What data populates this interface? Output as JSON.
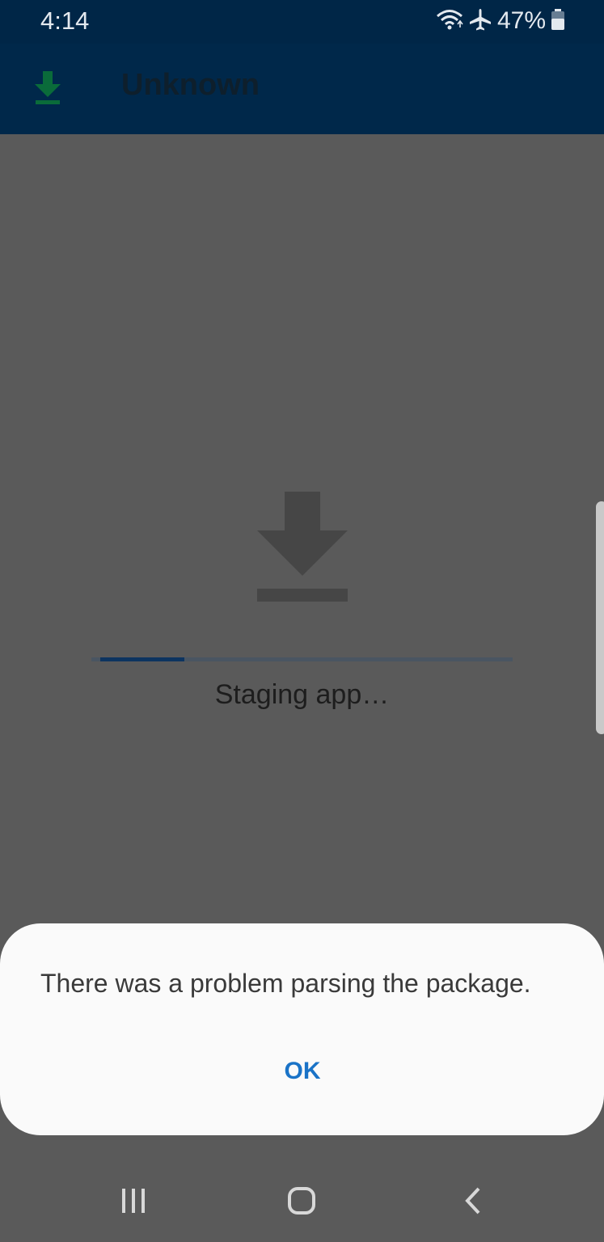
{
  "status_bar": {
    "time": "4:14",
    "battery_percent": "47%",
    "icons": [
      "wifi-icon",
      "airplane-icon",
      "battery-icon"
    ]
  },
  "app_bar": {
    "title": "Unknown",
    "icon": "download-icon",
    "icon_color": "#0a6b3a"
  },
  "content": {
    "graphic": "download-icon",
    "progress_label": "Staging app…",
    "progress_fraction": 0.2
  },
  "dialog": {
    "message": "There was a problem parsing the package.",
    "ok_label": "OK"
  },
  "navigation": {
    "buttons": [
      "recent-apps-icon",
      "home-icon",
      "back-icon"
    ]
  },
  "colors": {
    "status_bar_bg": "#002647",
    "app_bar_bg": "#00284a",
    "scrim": "#5a5a5a",
    "accent": "#1a73c7"
  }
}
